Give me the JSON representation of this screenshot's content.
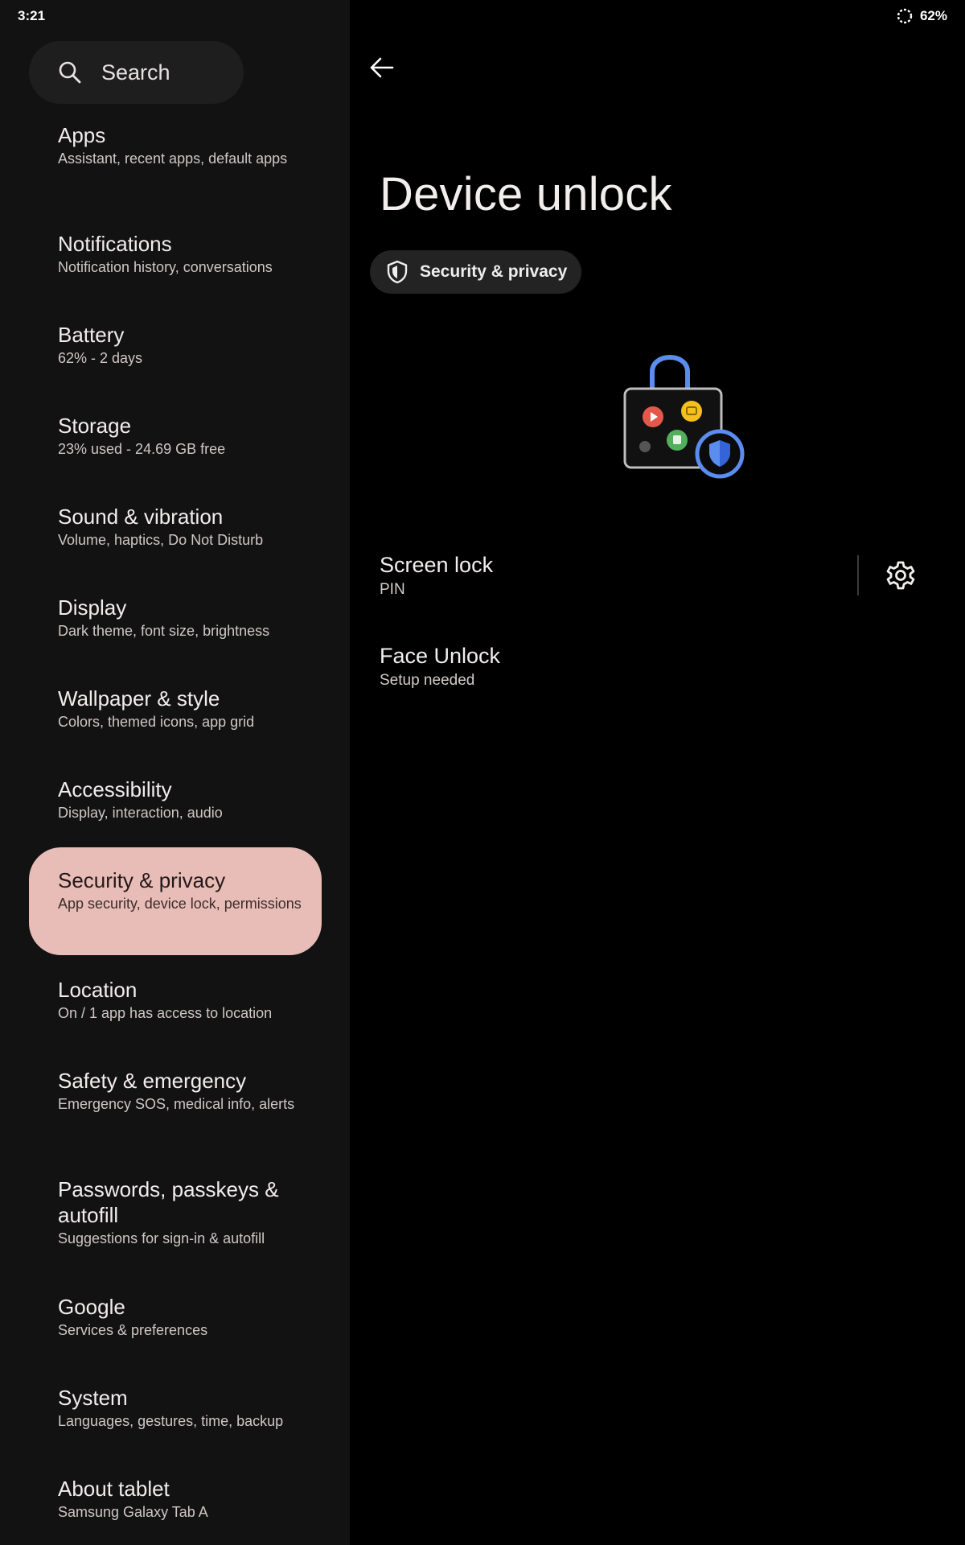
{
  "status": {
    "time": "3:21",
    "battery": "62%"
  },
  "sidebar": {
    "search_label": "Search",
    "items": [
      {
        "title": "Apps",
        "subtitle": "Assistant, recent apps, default apps"
      },
      {
        "title": "Notifications",
        "subtitle": "Notification history, conversations"
      },
      {
        "title": "Battery",
        "subtitle": "62% - 2 days"
      },
      {
        "title": "Storage",
        "subtitle": "23% used - 24.69 GB free"
      },
      {
        "title": "Sound & vibration",
        "subtitle": "Volume, haptics, Do Not Disturb"
      },
      {
        "title": "Display",
        "subtitle": "Dark theme, font size, brightness"
      },
      {
        "title": "Wallpaper & style",
        "subtitle": "Colors, themed icons, app grid"
      },
      {
        "title": "Accessibility",
        "subtitle": "Display, interaction, audio"
      },
      {
        "title": "Security & privacy",
        "subtitle": "App security, device lock, permissions",
        "selected": true
      },
      {
        "title": "Location",
        "subtitle": "On / 1 app has access to location"
      },
      {
        "title": "Safety & emergency",
        "subtitle": "Emergency SOS, medical info, alerts"
      },
      {
        "title": "Passwords, passkeys & autofill",
        "subtitle": "Suggestions for sign-in & autofill"
      },
      {
        "title": "Google",
        "subtitle": "Services & preferences"
      },
      {
        "title": "System",
        "subtitle": "Languages, gestures, time, backup"
      },
      {
        "title": "About tablet",
        "subtitle": "Samsung Galaxy Tab A"
      }
    ]
  },
  "main": {
    "title": "Device unlock",
    "chip_label": "Security & privacy",
    "rows": [
      {
        "title": "Screen lock",
        "subtitle": "PIN"
      },
      {
        "title": "Face Unlock",
        "subtitle": "Setup needed"
      }
    ]
  },
  "colors": {
    "background": "#000000",
    "sidebar": "#121212",
    "selected_item": "#e8bcb7",
    "illustration_blue": "#5b8def"
  },
  "icons": {
    "back": "arrow-left-icon",
    "search": "search-icon",
    "chip": "shield-icon",
    "settings": "gear-icon",
    "battery_status": "battery-saver-ring-icon"
  }
}
